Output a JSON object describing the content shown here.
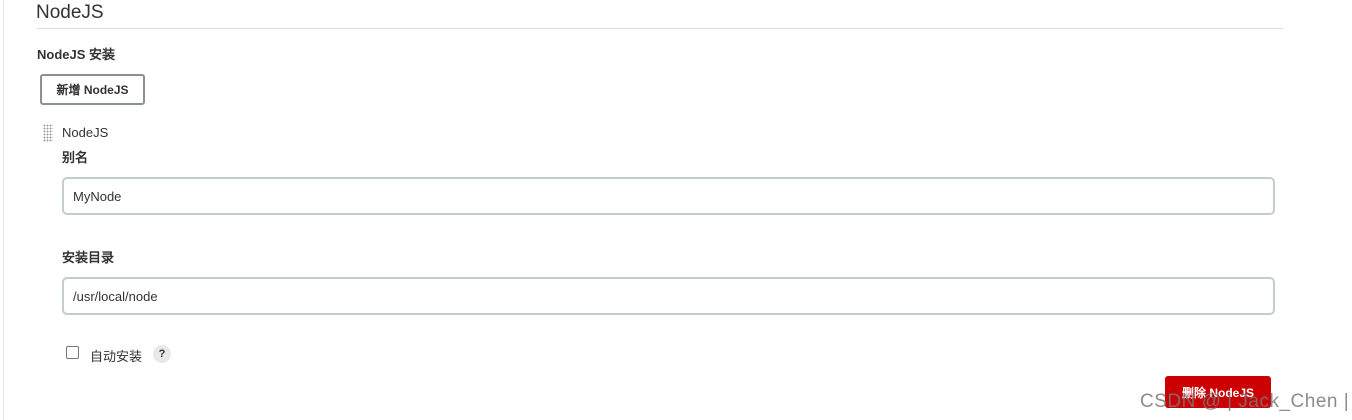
{
  "section": {
    "title": "NodeJS"
  },
  "subsection": {
    "title": "NodeJS 安装"
  },
  "buttons": {
    "add_label": "新增 NodeJS",
    "delete_label": "删除 NodeJS"
  },
  "item": {
    "header": "NodeJS",
    "alias": {
      "label": "别名",
      "value": "MyNode"
    },
    "install_dir": {
      "label": "安装目录",
      "value": "/usr/local/node"
    },
    "auto_install": {
      "label": "自动安装",
      "checked": false,
      "help_symbol": "?"
    }
  },
  "watermark": "CSDN @ | Jack_Chen |",
  "colors": {
    "danger": "#cc0003",
    "input_border": "#c3ccd1",
    "button_border": "#8a9099"
  }
}
